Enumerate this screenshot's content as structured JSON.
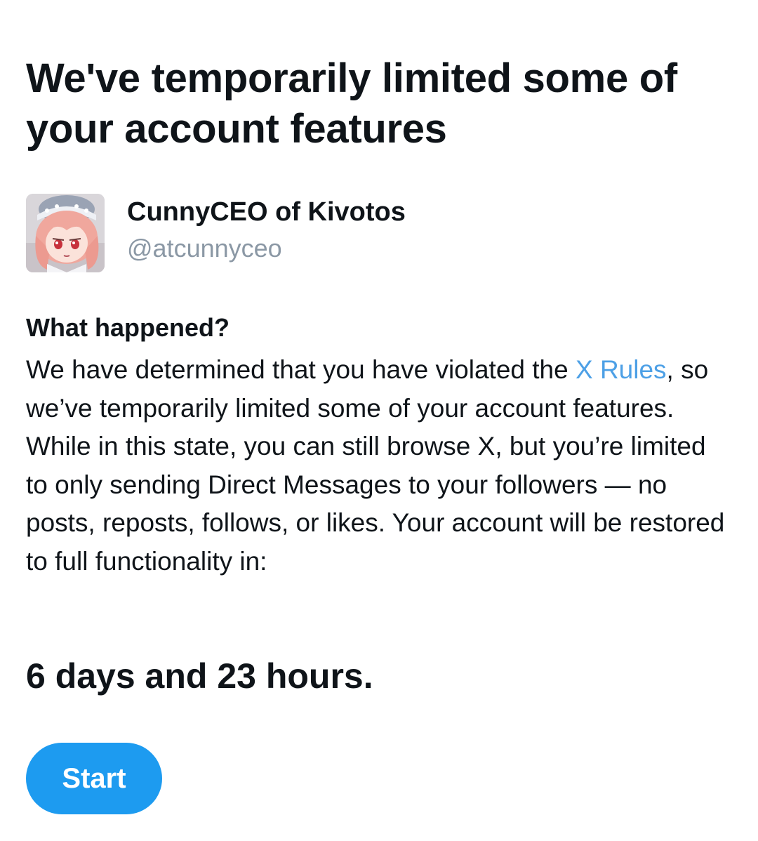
{
  "header": {
    "title": "We've temporarily limited some of your account features"
  },
  "account": {
    "display_name": "CunnyCEO of Kivotos",
    "handle": "@atcunnyceo",
    "avatar_icon": "anime-character-avatar"
  },
  "notice": {
    "heading": "What happened?",
    "body_before_link": "We have determined that you have violated the ",
    "link_text": "X Rules",
    "body_after_link": ", so we’ve temporarily limited some of your account features. While in this state, you can still browse X, but you’re limited to only sending Direct Messages to your followers — no posts, reposts, follows, or likes. Your account will be restored to full functionality in:",
    "countdown": "6 days and 23 hours."
  },
  "actions": {
    "start_label": "Start"
  },
  "colors": {
    "text": "#0f1419",
    "secondary_text": "#8b98a5",
    "link": "#4da0e6",
    "button_background": "#1d9bf0",
    "button_text": "#ffffff"
  }
}
